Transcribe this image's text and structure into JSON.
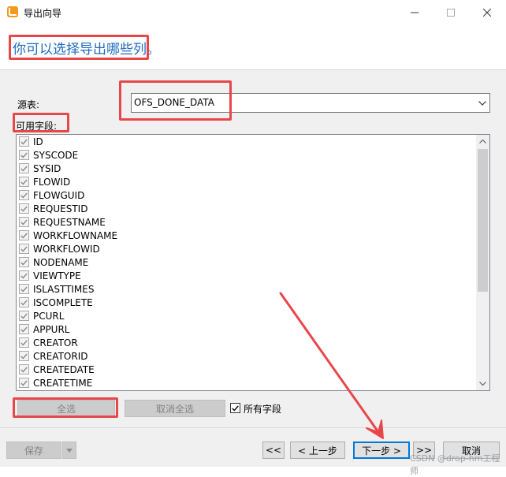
{
  "window": {
    "title": "导出向导",
    "minimize_icon": "minimize-icon",
    "maximize_icon": "maximize-icon",
    "close_icon": "close-icon"
  },
  "header": {
    "title": "你可以选择导出哪些列。",
    "color": "#1f6bbf"
  },
  "source": {
    "label": "源表:",
    "value": "OFS_DONE_DATA"
  },
  "fields": {
    "label": "可用字段:",
    "items": [
      {
        "label": "ID",
        "checked": true
      },
      {
        "label": "SYSCODE",
        "checked": true
      },
      {
        "label": "SYSID",
        "checked": true
      },
      {
        "label": "FLOWID",
        "checked": true
      },
      {
        "label": "FLOWGUID",
        "checked": true
      },
      {
        "label": "REQUESTID",
        "checked": true
      },
      {
        "label": "REQUESTNAME",
        "checked": true
      },
      {
        "label": "WORKFLOWNAME",
        "checked": true
      },
      {
        "label": "WORKFLOWID",
        "checked": true
      },
      {
        "label": "NODENAME",
        "checked": true
      },
      {
        "label": "VIEWTYPE",
        "checked": true
      },
      {
        "label": "ISLASTTIMES",
        "checked": true
      },
      {
        "label": "ISCOMPLETE",
        "checked": true
      },
      {
        "label": "PCURL",
        "checked": true
      },
      {
        "label": "APPURL",
        "checked": true
      },
      {
        "label": "CREATOR",
        "checked": true
      },
      {
        "label": "CREATORID",
        "checked": true
      },
      {
        "label": "CREATEDATE",
        "checked": true
      },
      {
        "label": "CREATETIME",
        "checked": true
      }
    ]
  },
  "actions": {
    "select_all": "全选",
    "deselect_all": "取消全选",
    "all_fields_label": "所有字段",
    "all_fields_checked": true
  },
  "footer": {
    "save": "保存",
    "first": "<<",
    "prev": "< 上一步",
    "next": "下一步 >",
    "last": ">>",
    "cancel": "取消"
  },
  "annotation_color": "#e8474a",
  "watermark": "CSDN @drop-hm工程师"
}
